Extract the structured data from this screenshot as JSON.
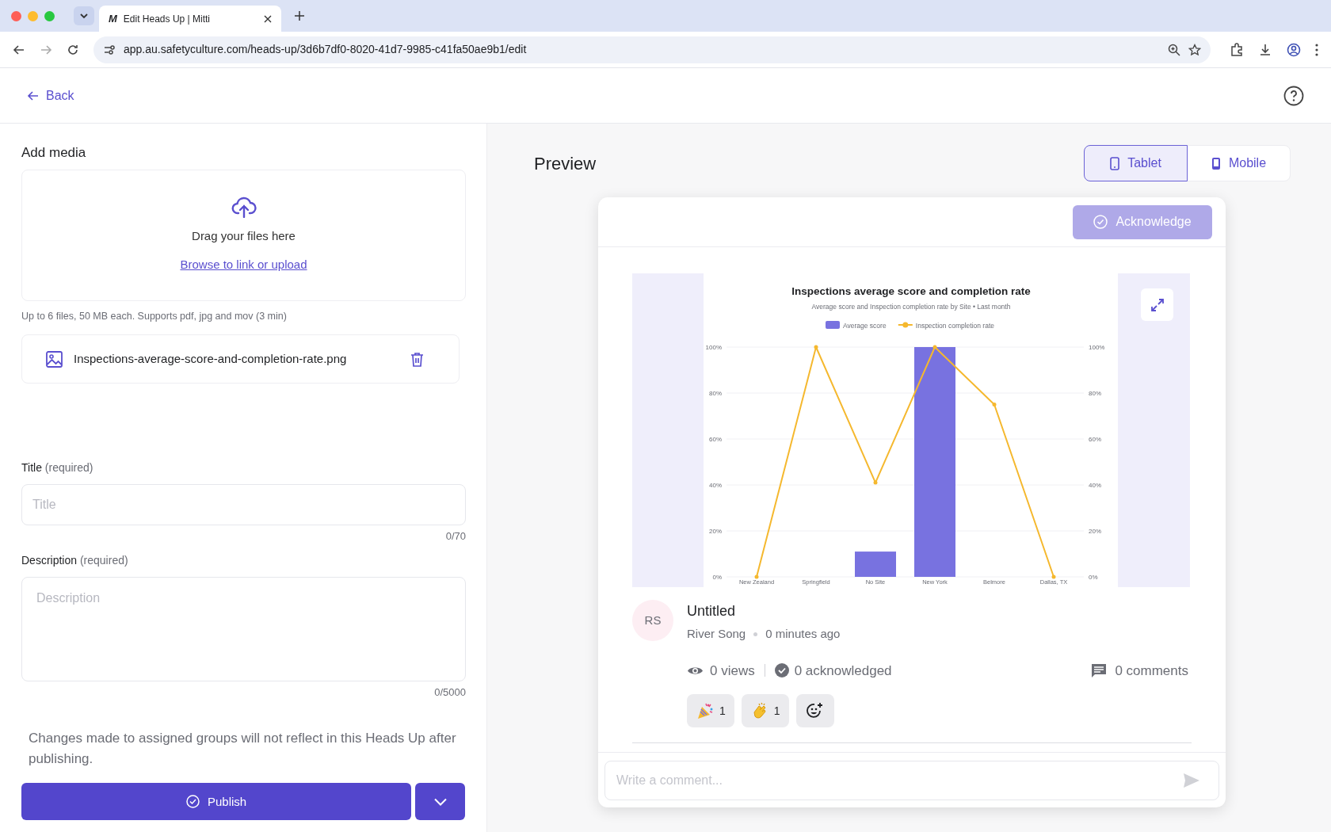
{
  "browser": {
    "tab_title": "Edit Heads Up | Mitti",
    "tab_logo": "M",
    "url": "app.au.safetyculture.com/heads-up/3d6b7df0-8020-41d7-9985-c41fa50ae9b1/edit"
  },
  "header": {
    "back_label": "Back"
  },
  "editor": {
    "media_title": "Add media",
    "drop_text": "Drag your files here",
    "browse_link": "Browse to link or upload",
    "media_hint": "Up to 6 files, 50 MB each. Supports pdf, jpg and mov (3 min)",
    "files": [
      {
        "name": "Inspections-average-score-and-completion-rate.png"
      }
    ],
    "fields": [
      {
        "kind": "input",
        "label": "Title",
        "qualifier": "(required)",
        "placeholder": "Title",
        "count": "0/70"
      },
      {
        "kind": "textarea",
        "label": "Description",
        "qualifier": "(required)",
        "placeholder": "Description",
        "count": "0/5000"
      }
    ],
    "note": "Changes made to assigned groups will not reflect in this Heads Up after publishing.",
    "publish_label": "Publish"
  },
  "preview": {
    "title": "Preview",
    "devices": [
      {
        "label": "Tablet",
        "selected": true
      },
      {
        "label": "Mobile",
        "selected": false
      }
    ],
    "acknowledge_label": "Acknowledge",
    "acknowledge_disabled": true,
    "chart_data": {
      "type": "bar",
      "title": "Inspections average score and completion rate",
      "subtitle": "Average score and Inspection completion rate by Site • Last month",
      "categories": [
        "New Zealand",
        "Springfield",
        "No Site",
        "New York",
        "Belmore",
        "Dallas, TX"
      ],
      "series": [
        {
          "name": "Average score",
          "color": "#7872e0",
          "values": [
            0,
            0,
            11,
            100,
            0,
            0
          ]
        },
        {
          "name": "Inspection completion rate",
          "type": "line",
          "color": "#f5b82e",
          "values": [
            0,
            100,
            41,
            100,
            75,
            0
          ]
        }
      ],
      "grid": true,
      "legend": "top",
      "ylim": [
        0,
        100
      ],
      "y2lim": [
        0,
        100
      ],
      "yticks": [
        {
          "value": 0,
          "label": "0%"
        },
        {
          "value": 20,
          "label": "20%"
        },
        {
          "value": 40,
          "label": "40%"
        },
        {
          "value": 60,
          "label": "60%"
        },
        {
          "value": 80,
          "label": "80%"
        },
        {
          "value": 100,
          "label": "100%"
        }
      ],
      "y2ticks": [
        {
          "value": 0,
          "label": "0%"
        },
        {
          "value": 20,
          "label": "20%"
        },
        {
          "value": 40,
          "label": "40%"
        },
        {
          "value": 60,
          "label": "60%"
        },
        {
          "value": 80,
          "label": "80%"
        },
        {
          "value": 100,
          "label": "100%"
        }
      ]
    },
    "post": {
      "initials": "RS",
      "title": "Untitled",
      "author": "River Song",
      "time": "0 minutes ago",
      "views": "0 views",
      "acknowledged": "0 acknowledged",
      "comments": "0 comments",
      "reactions": [
        {
          "kind": "party",
          "count": "1"
        },
        {
          "kind": "clap",
          "count": "1"
        }
      ]
    },
    "comment_placeholder": "Write a comment..."
  }
}
